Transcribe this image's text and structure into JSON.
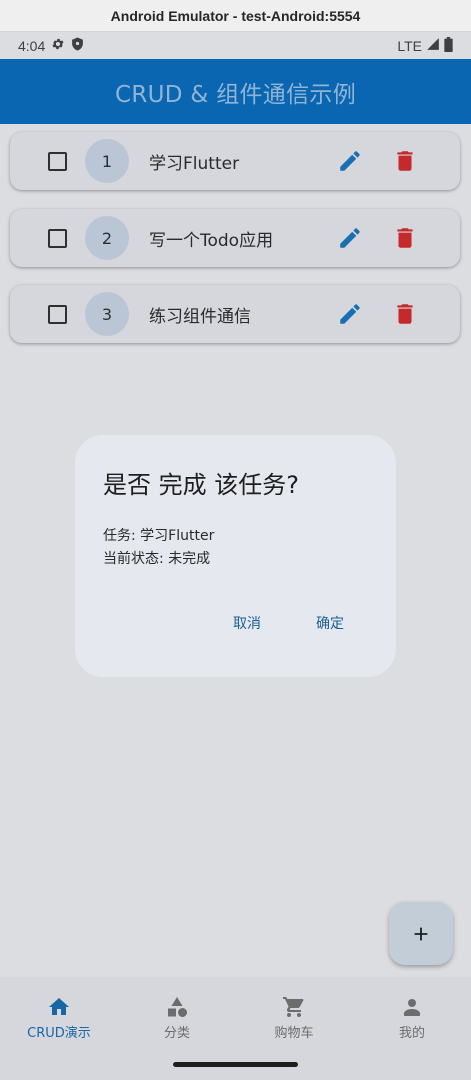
{
  "window": {
    "title": "Android Emulator - test-Android:5554"
  },
  "status_bar": {
    "time": "4:04",
    "network": "LTE"
  },
  "app_bar": {
    "title": "CRUD & 组件通信示例"
  },
  "todos": [
    {
      "index": "1",
      "text": "学习Flutter",
      "done": false
    },
    {
      "index": "2",
      "text": "写一个Todo应用",
      "done": false
    },
    {
      "index": "3",
      "text": "练习组件通信",
      "done": false
    }
  ],
  "dialog": {
    "title": "是否 完成 该任务?",
    "task_line": "任务: 学习Flutter",
    "status_line": "当前状态: 未完成",
    "cancel_label": "取消",
    "confirm_label": "确定"
  },
  "bottom_nav": [
    {
      "label": "CRUD演示",
      "icon": "home-icon",
      "active": true
    },
    {
      "label": "分类",
      "icon": "category-icon",
      "active": false
    },
    {
      "label": "购物车",
      "icon": "cart-icon",
      "active": false
    },
    {
      "label": "我的",
      "icon": "person-icon",
      "active": false
    }
  ],
  "colors": {
    "primary": "#0a66b0",
    "edit": "#1a6fb3",
    "delete": "#c42a2a",
    "dialog_bg": "#e6e8ef",
    "scrim": "#dcdde0"
  }
}
